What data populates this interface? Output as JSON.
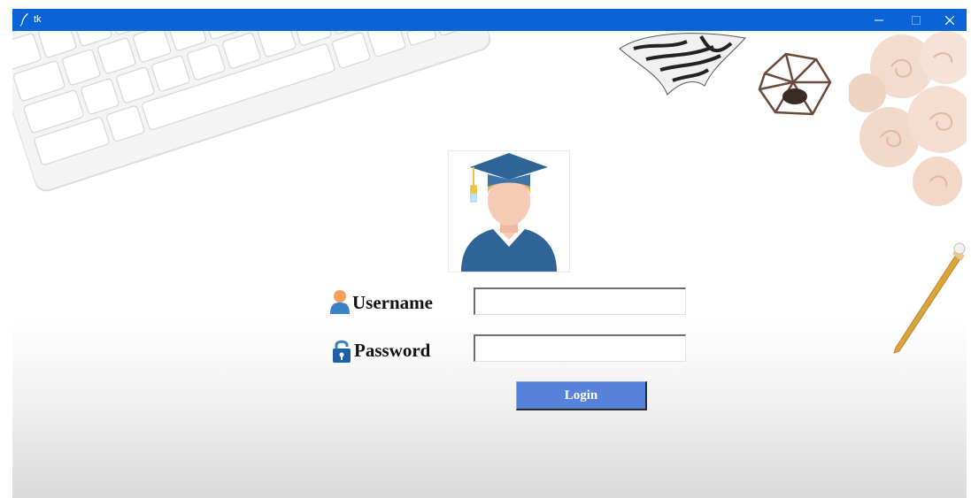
{
  "window": {
    "title": "tk",
    "icons": {
      "app": "feather-icon",
      "minimize": "minimize-icon",
      "maximize": "maximize-icon",
      "close": "close-icon"
    }
  },
  "login": {
    "avatar_icon": "graduate-student-icon",
    "username_label": "Username",
    "username_icon": "user-icon",
    "username_value": "",
    "password_label": "Password",
    "password_icon": "padlock-icon",
    "password_value": "",
    "login_button": "Login"
  },
  "colors": {
    "titlebar": "#0a64d7",
    "button": "#5683d9",
    "avatar_blue": "#2f6596",
    "skin": "#f5cbb4"
  }
}
